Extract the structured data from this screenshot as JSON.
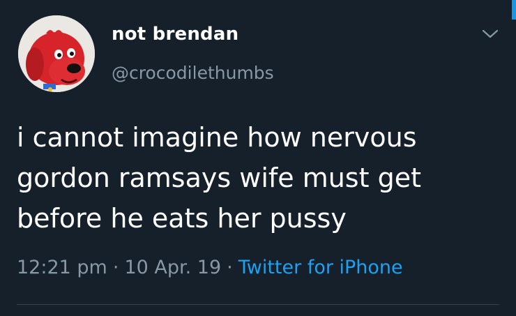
{
  "user": {
    "display_name": "not brendan",
    "handle": "@crocodilethumbs",
    "avatar_icon": "clifford-dog-avatar"
  },
  "tweet": {
    "lines": [
      "i cannot imagine how nervous",
      "gordon ramsays wife must get",
      "before he eats her pussy"
    ]
  },
  "meta": {
    "time": "12:21 pm",
    "date": "10 Apr. 19",
    "separator": "·",
    "source": "Twitter for iPhone"
  },
  "colors": {
    "background": "#15202b",
    "text": "#ffffff",
    "muted": "#8899a6",
    "accent": "#1da1f2"
  },
  "icons": {
    "more": "chevron-down-icon"
  }
}
